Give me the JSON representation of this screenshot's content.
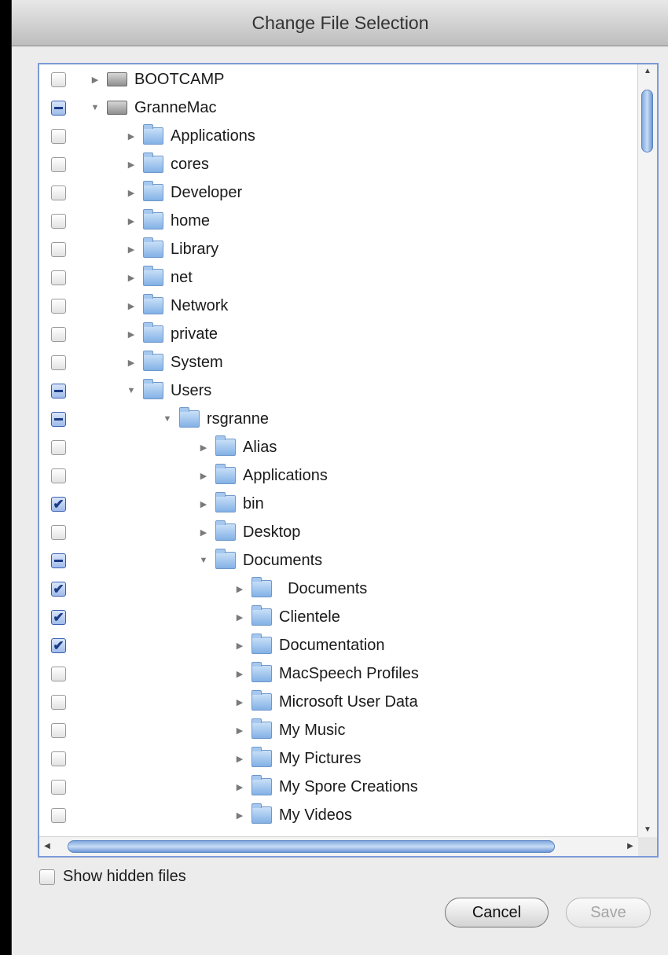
{
  "window": {
    "title": "Change File Selection"
  },
  "tree": {
    "rows": [
      {
        "label": "BOOTCAMP",
        "level": 0,
        "expanded": false,
        "check": "unchecked",
        "icon": "drive-icon"
      },
      {
        "label": "GranneMac",
        "level": 0,
        "expanded": true,
        "check": "mixed",
        "icon": "drive-icon"
      },
      {
        "label": "Applications",
        "level": 1,
        "expanded": false,
        "check": "unchecked",
        "icon": "folder-icon"
      },
      {
        "label": "cores",
        "level": 1,
        "expanded": false,
        "check": "unchecked",
        "icon": "folder-icon"
      },
      {
        "label": "Developer",
        "level": 1,
        "expanded": false,
        "check": "unchecked",
        "icon": "folder-icon"
      },
      {
        "label": "home",
        "level": 1,
        "expanded": false,
        "check": "unchecked",
        "icon": "folder-icon"
      },
      {
        "label": "Library",
        "level": 1,
        "expanded": false,
        "check": "unchecked",
        "icon": "folder-icon"
      },
      {
        "label": "net",
        "level": 1,
        "expanded": false,
        "check": "unchecked",
        "icon": "folder-icon"
      },
      {
        "label": "Network",
        "level": 1,
        "expanded": false,
        "check": "unchecked",
        "icon": "folder-icon"
      },
      {
        "label": "private",
        "level": 1,
        "expanded": false,
        "check": "unchecked",
        "icon": "folder-icon"
      },
      {
        "label": "System",
        "level": 1,
        "expanded": false,
        "check": "unchecked",
        "icon": "folder-icon"
      },
      {
        "label": "Users",
        "level": 1,
        "expanded": true,
        "check": "mixed",
        "icon": "folder-icon"
      },
      {
        "label": "rsgranne",
        "level": 2,
        "expanded": true,
        "check": "mixed",
        "icon": "folder-icon"
      },
      {
        "label": "Alias",
        "level": 3,
        "expanded": false,
        "check": "unchecked",
        "icon": "folder-icon"
      },
      {
        "label": "Applications",
        "level": 3,
        "expanded": false,
        "check": "unchecked",
        "icon": "folder-icon"
      },
      {
        "label": "bin",
        "level": 3,
        "expanded": false,
        "check": "checked",
        "icon": "folder-icon"
      },
      {
        "label": "Desktop",
        "level": 3,
        "expanded": false,
        "check": "unchecked",
        "icon": "folder-icon"
      },
      {
        "label": "Documents",
        "level": 3,
        "expanded": true,
        "check": "mixed",
        "icon": "folder-icon"
      },
      {
        "label": "  Documents",
        "level": 4,
        "expanded": false,
        "check": "checked",
        "icon": "folder-icon"
      },
      {
        "label": "Clientele",
        "level": 4,
        "expanded": false,
        "check": "checked",
        "icon": "folder-icon"
      },
      {
        "label": "Documentation",
        "level": 4,
        "expanded": false,
        "check": "checked",
        "icon": "folder-icon"
      },
      {
        "label": "MacSpeech Profiles",
        "level": 4,
        "expanded": false,
        "check": "unchecked",
        "icon": "folder-icon"
      },
      {
        "label": "Microsoft User Data",
        "level": 4,
        "expanded": false,
        "check": "unchecked",
        "icon": "folder-icon"
      },
      {
        "label": "My Music",
        "level": 4,
        "expanded": false,
        "check": "unchecked",
        "icon": "folder-icon"
      },
      {
        "label": "My Pictures",
        "level": 4,
        "expanded": false,
        "check": "unchecked",
        "icon": "folder-icon"
      },
      {
        "label": "My Spore Creations",
        "level": 4,
        "expanded": false,
        "check": "unchecked",
        "icon": "folder-icon"
      },
      {
        "label": "My Videos",
        "level": 4,
        "expanded": false,
        "check": "unchecked",
        "icon": "folder-icon"
      }
    ]
  },
  "options": {
    "show_hidden_label": "Show hidden files"
  },
  "buttons": {
    "cancel": "Cancel",
    "save": "Save"
  }
}
